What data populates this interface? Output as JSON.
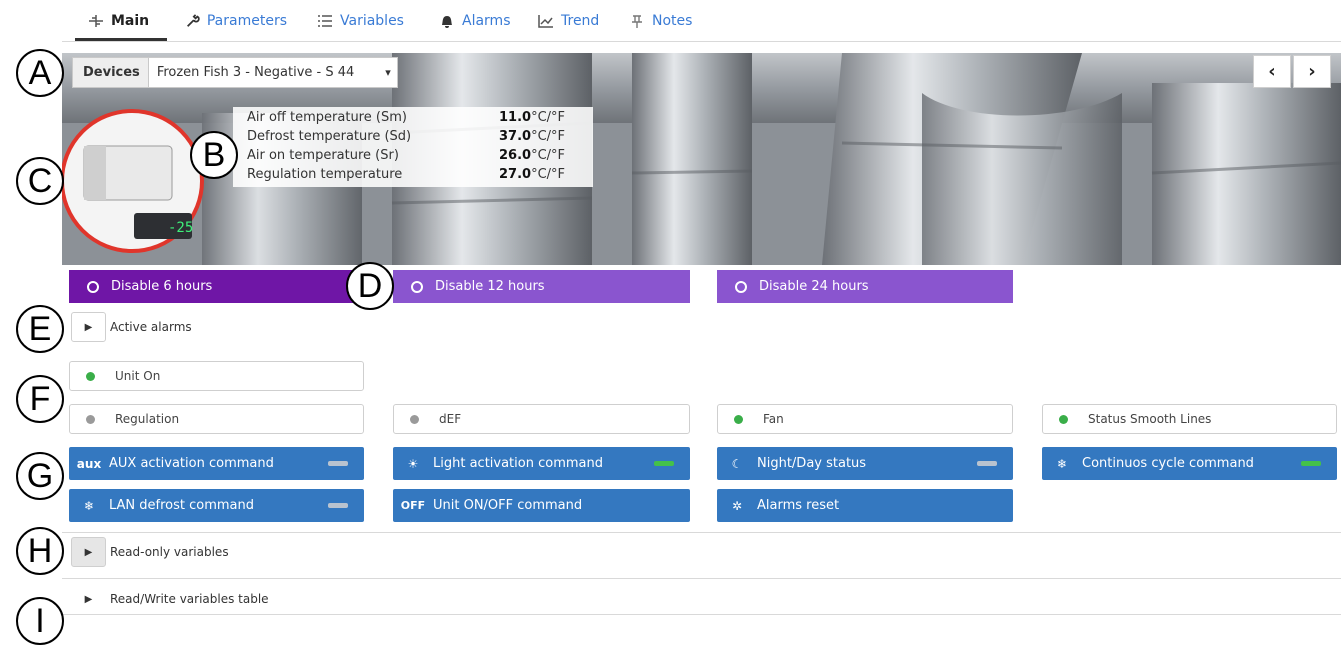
{
  "tabs": [
    {
      "label": "Main",
      "icon": "tree-icon",
      "active": true
    },
    {
      "label": "Parameters",
      "icon": "wrench-icon"
    },
    {
      "label": "Variables",
      "icon": "list-icon"
    },
    {
      "label": "Alarms",
      "icon": "bell-icon"
    },
    {
      "label": "Trend",
      "icon": "chart-icon"
    },
    {
      "label": "Notes",
      "icon": "pin-icon"
    }
  ],
  "devices": {
    "label": "Devices",
    "selected": "Frozen Fish 3 - Negative - S 44"
  },
  "temperatures": [
    {
      "name": "Air off temperature (Sm)",
      "value": "11.0",
      "unit": "°C/°F"
    },
    {
      "name": "Defrost temperature (Sd)",
      "value": "37.0",
      "unit": "°C/°F"
    },
    {
      "name": "Air on temperature (Sr)",
      "value": "26.0",
      "unit": "°C/°F"
    },
    {
      "name": "Regulation temperature",
      "value": "27.0",
      "unit": "°C/°F"
    }
  ],
  "device_display": "-25",
  "disable_buttons": [
    "Disable 6 hours",
    "Disable 12 hours",
    "Disable 24 hours"
  ],
  "sections": {
    "active_alarms": "Active alarms",
    "read_only": "Read-only variables",
    "read_write": "Read/Write variables table"
  },
  "statuses": [
    {
      "label": "Unit On",
      "color": "#3aae49"
    },
    {
      "label": "Regulation",
      "color": "#9a9a9a"
    },
    {
      "label": "dEF",
      "color": "#9a9a9a"
    },
    {
      "label": "Fan",
      "color": "#3aae49"
    },
    {
      "label": "Status Smooth Lines",
      "color": "#3aae49"
    }
  ],
  "commands": [
    {
      "label": "AUX activation command",
      "icon_text": "aux",
      "icon": "aux-icon",
      "led": "#b9c3cf"
    },
    {
      "label": "Light activation command",
      "icon_text": "☀",
      "icon": "lightbulb-icon",
      "led": "#44c14a"
    },
    {
      "label": "Night/Day status",
      "icon_text": "☾",
      "icon": "moon-icon",
      "led": "#b9c3cf"
    },
    {
      "label": "Continuos cycle command",
      "icon_text": "❄",
      "icon": "cycle-icon",
      "led": "#44c14a"
    },
    {
      "label": "LAN defrost command",
      "icon_text": "❄",
      "icon": "defrost-icon",
      "led": "#b9c3cf"
    },
    {
      "label": "Unit ON/OFF command",
      "icon_text": "OFF",
      "icon": "power-icon",
      "led": ""
    },
    {
      "label": "Alarms reset",
      "icon_text": "✲",
      "icon": "alarm-reset-icon",
      "led": ""
    }
  ],
  "callouts": [
    "A",
    "B",
    "C",
    "D",
    "E",
    "F",
    "G",
    "H",
    "I"
  ],
  "colors": {
    "accent_blue": "#3478c0",
    "purple": "#8a55cf",
    "purple_active": "#6f16a6",
    "link": "#3a7bd5"
  }
}
